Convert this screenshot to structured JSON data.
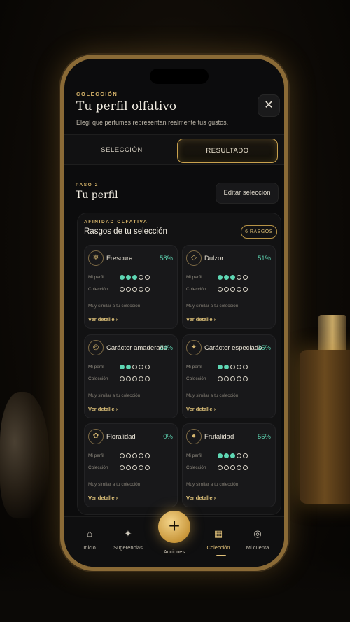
{
  "header": {
    "eyebrow": "COLECCIÓN",
    "title": "Tu perfil olfativo",
    "subtitle": "Elegí qué perfumes representan realmente tus gustos.",
    "close_icon": "close-icon"
  },
  "tabs": [
    {
      "label": "SELECCIÓN",
      "active": false
    },
    {
      "label": "RESULTADO",
      "active": true
    }
  ],
  "step": {
    "eyebrow": "PASO 2",
    "title": "Tu perfil",
    "edit_label": "Editar selección"
  },
  "traits": {
    "eyebrow": "AFINIDAD OLFATIVA",
    "title": "Rasgos de tu selección",
    "count_badge": "6 RASGOS",
    "row_labels": {
      "profile": "Mi perfil",
      "collection": "Colección"
    },
    "items": [
      {
        "name": "Frescura",
        "percent": "58%",
        "icon": "snowflake-icon",
        "profile_level": 3,
        "collection_level": 0,
        "note": "Muy similar a tu colección",
        "link": "Ver detalle"
      },
      {
        "name": "Dulzor",
        "percent": "51%",
        "icon": "diamond-icon",
        "profile_level": 3,
        "collection_level": 0,
        "note": "Muy similar a tu colección",
        "link": "Ver detalle"
      },
      {
        "name": "Carácter amaderado",
        "percent": "34%",
        "icon": "ring-icon",
        "profile_level": 2,
        "collection_level": 0,
        "note": "Muy similar a tu colección",
        "link": "Ver detalle"
      },
      {
        "name": "Carácter especiado",
        "percent": "35%",
        "icon": "spark-icon",
        "profile_level": 2,
        "collection_level": 0,
        "note": "Muy similar a tu colección",
        "link": "Ver detalle"
      },
      {
        "name": "Floralidad",
        "percent": "0%",
        "icon": "flower-icon",
        "profile_level": 0,
        "collection_level": 0,
        "note": "Muy similar a tu colección",
        "link": "Ver detalle"
      },
      {
        "name": "Frutalidad",
        "percent": "55%",
        "icon": "drop-icon",
        "profile_level": 3,
        "collection_level": 0,
        "note": "Muy similar a tu colección",
        "link": "Ver detalle"
      }
    ]
  },
  "nav": [
    {
      "label": "Inicio",
      "icon": "home-icon",
      "active": false
    },
    {
      "label": "Sugerencias",
      "icon": "sparkle-icon",
      "active": false
    },
    {
      "label": "Acciones",
      "icon": "plus-icon",
      "active": false
    },
    {
      "label": "Colección",
      "icon": "grid-icon",
      "active": true
    },
    {
      "label": "Mi cuenta",
      "icon": "user-icon",
      "active": false
    }
  ],
  "colors": {
    "accent": "#d6b46a",
    "positive": "#5ed6b3",
    "background": "#0c0c0d"
  }
}
